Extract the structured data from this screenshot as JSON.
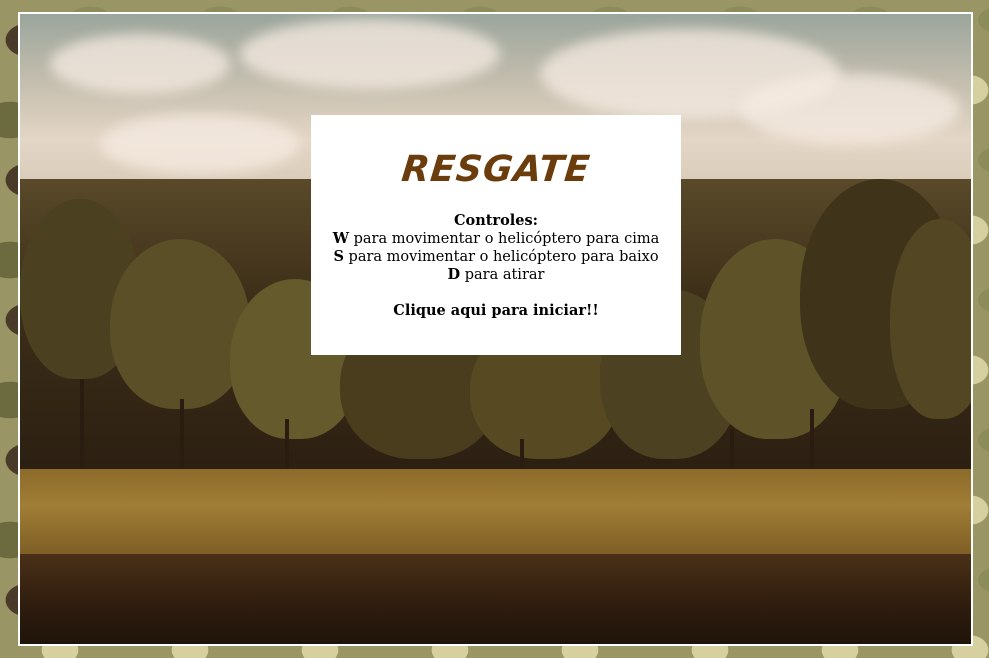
{
  "game": {
    "title": "RESGATE",
    "controls_heading": "Controles:",
    "controls": [
      {
        "key": "W",
        "text": " para movimentar o helicóptero para cima"
      },
      {
        "key": "S",
        "text": " para movimentar o helicóptero para baixo"
      },
      {
        "key": "D",
        "text": " para atirar"
      }
    ],
    "start_prompt": "Clique aqui para iniciar!!"
  },
  "colors": {
    "title": "#6b3d0c",
    "panel_background": "#ffffff",
    "frame_border": "#ffffff"
  }
}
